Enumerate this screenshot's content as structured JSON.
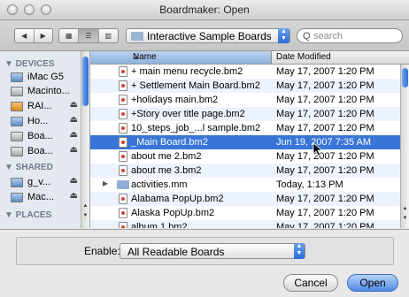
{
  "window": {
    "title": "Boardmaker: Open"
  },
  "toolbar": {
    "back_icon": "◀",
    "forward_icon": "▶",
    "view_icon_icon": "▦",
    "view_list_icon": "☰",
    "view_column_icon": "▥",
    "location": "Interactive Sample Boards vi",
    "search_placeholder": "search",
    "search_icon": "Q"
  },
  "sidebar": {
    "devices_header": "▼ DEVICES",
    "devices": [
      {
        "label": "iMac G5",
        "icon": "imac-icon",
        "eject": ""
      },
      {
        "label": "Macinto...",
        "icon": "hard-drive-icon",
        "eject": ""
      },
      {
        "label": "RAI...",
        "icon": "drive-icon",
        "eject": "⏏"
      },
      {
        "label": "Ho...",
        "icon": "drive-icon",
        "eject": "⏏"
      },
      {
        "label": "Boa...",
        "icon": "disk-icon",
        "eject": "⏏"
      },
      {
        "label": "Boa...",
        "icon": "disk-icon",
        "eject": "⏏"
      }
    ],
    "shared_header": "▼ SHARED",
    "shared": [
      {
        "label": "g_v...",
        "icon": "network-icon",
        "eject": "⏏"
      },
      {
        "label": "Mac...",
        "icon": "network-icon",
        "eject": "⏏"
      }
    ],
    "places_header": "▼ PLACES"
  },
  "filelist": {
    "col_name": "Name",
    "col_date": "Date Modified",
    "sort_indicator": "▲",
    "rows": [
      {
        "name": "+ main menu recycle.bm2",
        "date": "May 17, 2007 1:20 PM",
        "kind": "file"
      },
      {
        "name": "+ Settlement Main Board.bm2",
        "date": "May 17, 2007 1:20 PM",
        "kind": "file"
      },
      {
        "name": "+holidays main.bm2",
        "date": "May 17, 2007 1:20 PM",
        "kind": "file"
      },
      {
        "name": "+Story over title page.bm2",
        "date": "May 17, 2007 1:20 PM",
        "kind": "file"
      },
      {
        "name": "10_steps_job_...l sample.bm2",
        "date": "May 17, 2007 1:20 PM",
        "kind": "file"
      },
      {
        "name": "_Main Board.bm2",
        "date": "Jun 19, 2007 7:35 AM",
        "kind": "file",
        "selected": true
      },
      {
        "name": "about me 2.bm2",
        "date": "May 17, 2007 1:20 PM",
        "kind": "file"
      },
      {
        "name": "about me 3.bm2",
        "date": "May 17, 2007 1:20 PM",
        "kind": "file"
      },
      {
        "name": "activities.mm",
        "date": "Today, 1:13 PM",
        "kind": "folder"
      },
      {
        "name": "Alabama PopUp.bm2",
        "date": "May 17, 2007 1:20 PM",
        "kind": "file"
      },
      {
        "name": "Alaska PopUp.bm2",
        "date": "May 17, 2007 1:20 PM",
        "kind": "file"
      },
      {
        "name": "album 1.bm2",
        "date": "May 17, 2007 1:20 PM",
        "kind": "file"
      }
    ]
  },
  "bottom": {
    "enable_label": "Enable:",
    "enable_value": "All Readable Boards",
    "cancel_label": "Cancel",
    "open_label": "Open"
  }
}
